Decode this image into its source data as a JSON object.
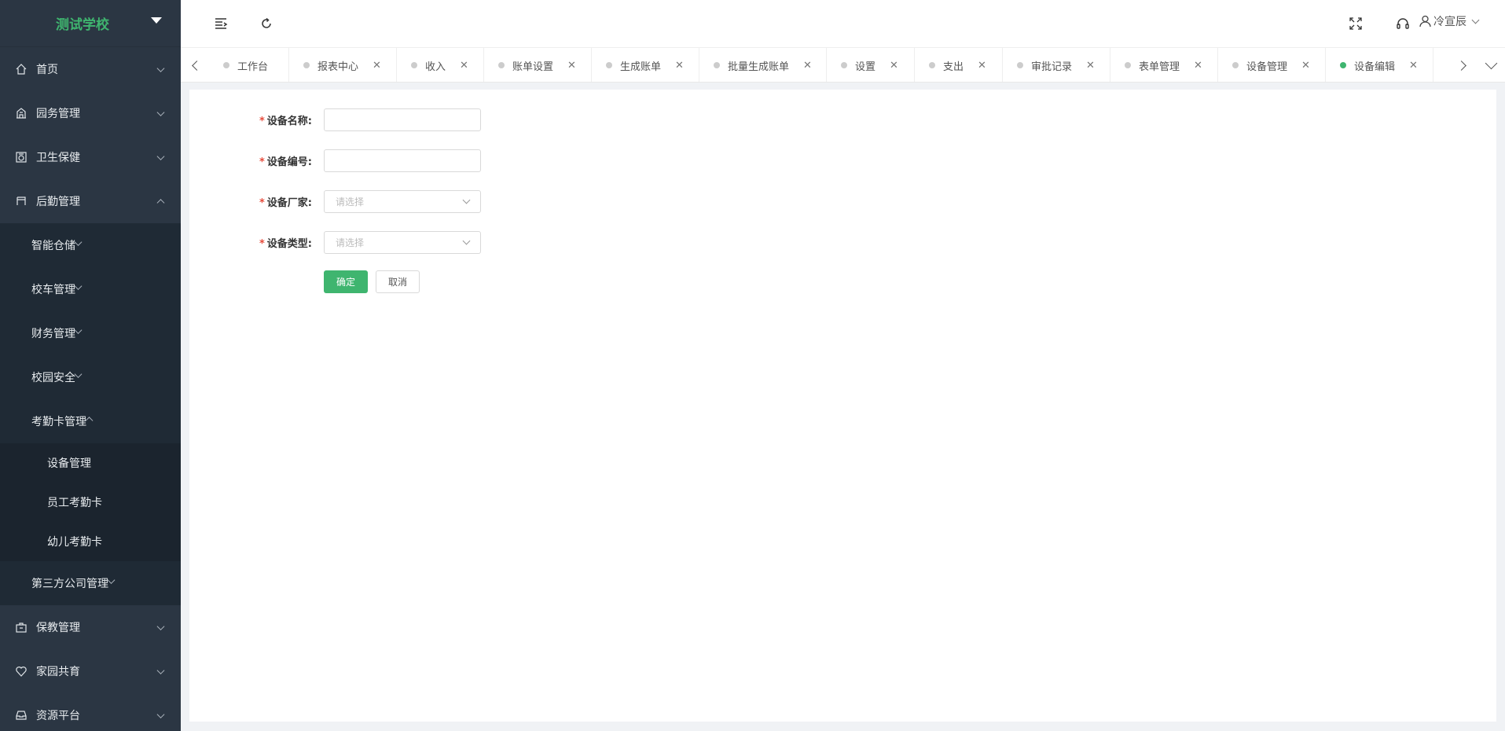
{
  "sidebar": {
    "school": "测试学校",
    "items": [
      {
        "label": "首页",
        "icon": "home-icon"
      },
      {
        "label": "园务管理",
        "icon": "building-icon"
      },
      {
        "label": "卫生保健",
        "icon": "health-icon"
      },
      {
        "label": "后勤管理",
        "icon": "logistics-icon",
        "expanded": true
      }
    ],
    "logistics_sub": [
      {
        "label": "智能仓储"
      },
      {
        "label": "校车管理"
      },
      {
        "label": "财务管理"
      },
      {
        "label": "校园安全"
      },
      {
        "label": "考勤卡管理",
        "expanded": true
      }
    ],
    "attendance_sub": [
      {
        "label": "设备管理"
      },
      {
        "label": "员工考勤卡"
      },
      {
        "label": "幼儿考勤卡"
      }
    ],
    "third_party": "第三方公司管理",
    "bottom_items": [
      {
        "label": "保教管理",
        "icon": "education-icon"
      },
      {
        "label": "家园共育",
        "icon": "heart-icon"
      },
      {
        "label": "资源平台",
        "icon": "inbox-icon"
      }
    ]
  },
  "topbar": {
    "user_name": "冷宣辰"
  },
  "tabs": [
    {
      "label": "工作台",
      "closable": false
    },
    {
      "label": "报表中心",
      "closable": true
    },
    {
      "label": "收入",
      "closable": true
    },
    {
      "label": "账单设置",
      "closable": true
    },
    {
      "label": "生成账单",
      "closable": true
    },
    {
      "label": "批量生成账单",
      "closable": true
    },
    {
      "label": "设置",
      "closable": true
    },
    {
      "label": "支出",
      "closable": true
    },
    {
      "label": "审批记录",
      "closable": true
    },
    {
      "label": "表单管理",
      "closable": true
    },
    {
      "label": "设备管理",
      "closable": true
    },
    {
      "label": "设备编辑",
      "closable": true,
      "active": true
    }
  ],
  "form": {
    "name_label": "设备名称:",
    "name_value": "",
    "code_label": "设备编号:",
    "code_value": "",
    "vendor_label": "设备厂家:",
    "vendor_placeholder": "请选择",
    "type_label": "设备类型:",
    "type_placeholder": "请选择",
    "required_mark": "*",
    "confirm": "确定",
    "cancel": "取消"
  },
  "colors": {
    "accent": "#3fb56f",
    "sidebar_bg": "#2b3643",
    "required": "#e74c3c"
  }
}
